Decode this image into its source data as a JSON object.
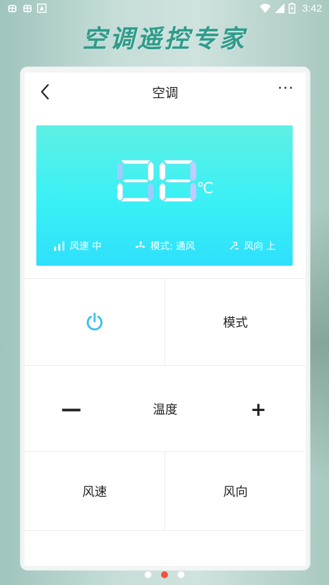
{
  "status_bar": {
    "time": "3:42",
    "left_icons": [
      "bug-icon",
      "bug-icon",
      "notification-icon"
    ],
    "right_icons": [
      "wifi-icon",
      "signal-icon",
      "battery-icon"
    ]
  },
  "hero": {
    "title": "空调遥控专家"
  },
  "nav": {
    "title": "空调",
    "more_label": "···"
  },
  "display": {
    "temperature": "28",
    "unit": "℃",
    "fan_speed": "风速 中",
    "mode": "模式: 通风",
    "direction": "风向 上"
  },
  "controls": {
    "power_icon": "power-icon",
    "mode_label": "模式",
    "minus_label": "—",
    "temp_label": "温度",
    "plus_label": "+",
    "speed_label": "风速",
    "direction_label": "风向"
  },
  "pager": {
    "count": 3,
    "active_index": 1
  },
  "colors": {
    "accent": "#2e9c8b",
    "panel_top": "#5ef0e4",
    "panel_bottom": "#2fe0fb",
    "power": "#3cc0ec",
    "active_dot": "#f0503c"
  }
}
